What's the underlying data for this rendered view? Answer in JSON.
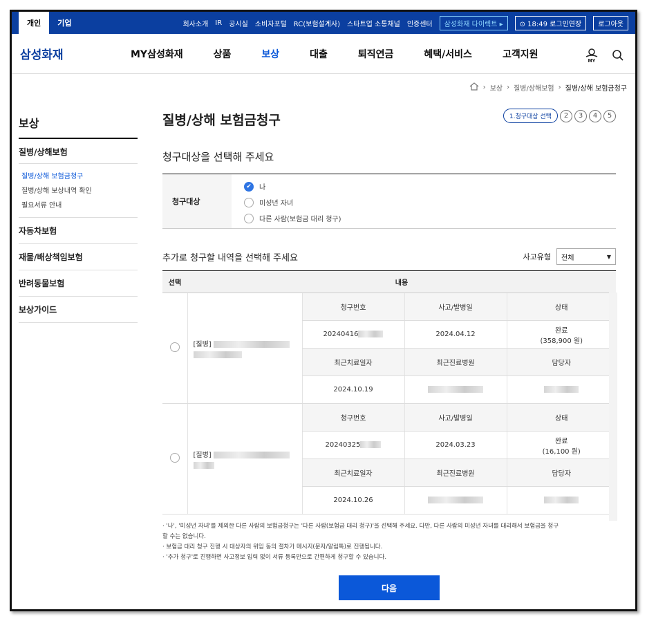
{
  "topbar": {
    "segments": [
      "개인",
      "기업"
    ],
    "utils": [
      "회사소개",
      "IR",
      "공시실",
      "소비자포털",
      "RC(보험설계사)",
      "스타트업 소통채널",
      "인증센터"
    ],
    "direct": "삼성화재 다이렉트 ▸",
    "session": "⊙ 18:49 로그인연장",
    "logout": "로그아웃"
  },
  "gnb": {
    "logo": "삼성화재",
    "menu": [
      "MY삼성화재",
      "상품",
      "보상",
      "대출",
      "퇴직연금",
      "혜택/서비스",
      "고객지원"
    ],
    "my_label": "MY"
  },
  "breadcrumb": [
    "보상",
    "질병/상해보험",
    "질병/상해 보험금청구"
  ],
  "sidebar": {
    "title": "보상",
    "group": "질병/상해보험",
    "sub": [
      "질병/상해 보험금청구",
      "질병/상해 보상내역 확인",
      "필요서류 안내"
    ],
    "items": [
      "자동차보험",
      "재물/배상책임보험",
      "반려동물보험",
      "보상가이드"
    ]
  },
  "main": {
    "title": "질병/상해 보험금청구",
    "step_active": "1.청구대상 선택",
    "steps": [
      "2",
      "3",
      "4",
      "5"
    ],
    "section1": "청구대상을 선택해 주세요",
    "target_label": "청구대상",
    "options": [
      "나",
      "미성년 자녀",
      "다른 사람(보험금 대리 청구)"
    ],
    "icon_check": "✔",
    "section2": "추가로 청구할 내역을 선택해 주세요",
    "filter_label": "사고유형",
    "filter_value": "전체",
    "filter_caret": "▼",
    "table": {
      "h_select": "선택",
      "h_content": "내용",
      "cols1": [
        "청구번호",
        "사고/발병일",
        "상태"
      ],
      "cols2": [
        "최근치료일자",
        "최근진료병원",
        "담당자"
      ],
      "rows": [
        {
          "type": "[질병]",
          "claim_no": "20240416",
          "date": "2024.04.12",
          "status": "완료",
          "amount": "(358,900 원)",
          "last_date": "2024.10.19"
        },
        {
          "type": "[질병]",
          "claim_no": "20240325",
          "date": "2024.03.23",
          "status": "완료",
          "amount": "(16,100 원)",
          "last_date": "2024.10.26"
        }
      ]
    },
    "notes": [
      "· '나', '미성년 자녀'를 제외한 다른 사람의 보험금청구는 '다른 사람(보험금 대리 청구)'을 선택해 주세요. 다만, 다른 사람의 미성년 자녀를 대리해서 보험금을 청구",
      "  할 수는 없습니다.",
      "· 보험금 대리 청구 진행 시 대상자의 위임 동의 절차가 메시지(문자/알림톡)로 진행됩니다.",
      "· '추가 청구'로 진행하면 사고정보 입력 없이 서류 등록만으로 간편하게 청구할 수 있습니다."
    ],
    "next": "다음"
  }
}
